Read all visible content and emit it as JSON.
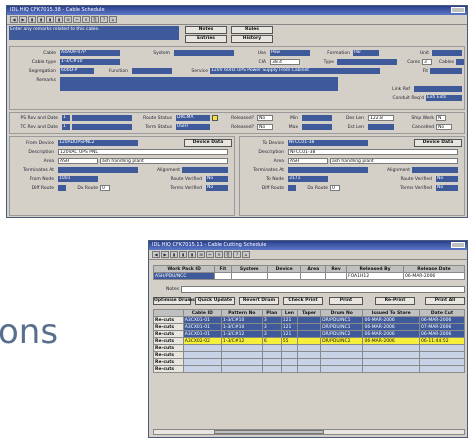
{
  "w1": {
    "title": "IDL HIQ CFK7015.38 - Cable Schedule",
    "hint": "Enter any remarks related to this cable.",
    "nav": [
      "Notes",
      "Rules",
      "Entries",
      "History"
    ],
    "labels": {
      "cable": "Cable",
      "system": "System",
      "cable_type": "Cable type",
      "segregation": "Segregation",
      "function": "Function",
      "remarks": "Remarks",
      "use": "Use",
      "cia": "CIA",
      "formation": "Formation",
      "type": "Type",
      "unit": "Unit",
      "cores": "Cores",
      "cables": "Cables",
      "service": "Service",
      "fit": "Fit",
      "link_ref": "Link Ref",
      "conduit": "Conduit Req'd",
      "ps_rev": "PS Rev and Date",
      "tc_rev": "TC Rev and Date",
      "route_status": "Route Status",
      "term_status": "Term Status",
      "released": "Released?",
      "min": "Min",
      "max": "Max",
      "des_len": "Des Len",
      "est_len": "Est Len",
      "ship_work": "Ship Work",
      "cancelled": "Cancelled"
    },
    "values": {
      "cable": "A4A09-07P",
      "cable_type": "1-3/C#10",
      "segregation": "600D-P",
      "use": "Pow",
      "cia": "38.4",
      "formation": "Par",
      "cores": "3",
      "service": "120V 60Hz UPS Power Supply From Cabinet",
      "conduit": "Exh Exts",
      "ps_num": "1",
      "tc_num": "1",
      "route_status": "DRCMA",
      "term_status": "USHI",
      "released1": "No",
      "released2": "No",
      "des_len": "122.8",
      "ship_work": "N",
      "cancelled": "No"
    },
    "from": {
      "title": "From Device",
      "btn": "Device Data",
      "device": "120ADUPSPNL2",
      "desc": "120VAC UPS PNL",
      "area": "ASH",
      "area_desc": "ash handling plant",
      "terminates_at": "Terminates At",
      "alignment": "Alignment",
      "node_lbl": "From Node",
      "node": "1001",
      "diff_lbl": "Diff Route",
      "route_lbl": "Dx Route",
      "route": "0",
      "rv_lbl": "Route Verified",
      "rv": "No",
      "tv_lbl": "Terms Verified",
      "tv": "No"
    },
    "to": {
      "title": "To Device",
      "btn": "Device Data",
      "device": "NFCC01-38",
      "desc": "NFCC01-38",
      "area": "ASH",
      "area_desc": "ash handling plant",
      "terminates_at": "Terminates At",
      "alignment": "Alignment",
      "node_lbl": "To Node",
      "node": "3171",
      "diff_lbl": "Diff Route",
      "route_lbl": "Dx Route",
      "route": "0",
      "rv_lbl": "Route Verified",
      "rv": "No",
      "tv_lbl": "Terms Verified",
      "tv": "No"
    }
  },
  "big_text": "ons",
  "w2": {
    "title": "IDL HIQ CFK7015.11 - Cable Cutting Schedule",
    "headers": [
      "Work Pack ID",
      "Fit",
      "System",
      "Device",
      "Area",
      "Rev",
      "Released By",
      "Release Date"
    ],
    "row": [
      "ASH/PDU/NCC",
      "",
      "",
      "",
      "",
      "",
      "FOA1H12",
      "06-MAR-2006"
    ],
    "notes_lbl": "Notes",
    "buttons": [
      "Optimise Drums",
      "Quick Update",
      "Revert Drum",
      "Check Print",
      "Print",
      "Re-Print",
      "Print All"
    ],
    "cols": [
      "",
      "Cable ID",
      "Pattern No",
      "Plan",
      "Len",
      "Taper",
      "Drum No",
      "Issued To Store",
      "Date Cut"
    ],
    "rows": [
      [
        "Re-cuts",
        "A3CX01-01",
        "1-3/C#10",
        "3",
        "121",
        "",
        "DR/PDU/NC1",
        "06-MAR-2006",
        "06-MAR-2006"
      ],
      [
        "Re-cuts",
        "A3CX01-01",
        "1-3/C#10",
        "3",
        "121",
        "",
        "DR/PDU/NC1",
        "06-MAR-2006",
        "07-MAR-2006"
      ],
      [
        "Re-cuts",
        "A3CX01-01",
        "1-3/C#12",
        "3",
        "121",
        "",
        "DR/PDU/NC2",
        "06-MAR-2006",
        "06-MAR-2006"
      ],
      [
        "Re-cuts",
        "A3CX02-02",
        "1-3/C#12",
        "6",
        "55",
        "",
        "DR/PDU/NC2",
        "06-MAR-2006",
        "06-11:44:52"
      ],
      [
        "Re-cuts",
        "",
        "",
        "",
        "",
        "",
        "",
        "",
        ""
      ],
      [
        "Re-cuts",
        "",
        "",
        "",
        "",
        "",
        "",
        "",
        ""
      ],
      [
        "Re-cuts",
        "",
        "",
        "",
        "",
        "",
        "",
        "",
        ""
      ],
      [
        "Re-cuts",
        "",
        "",
        "",
        "",
        "",
        "",
        "",
        ""
      ]
    ]
  }
}
